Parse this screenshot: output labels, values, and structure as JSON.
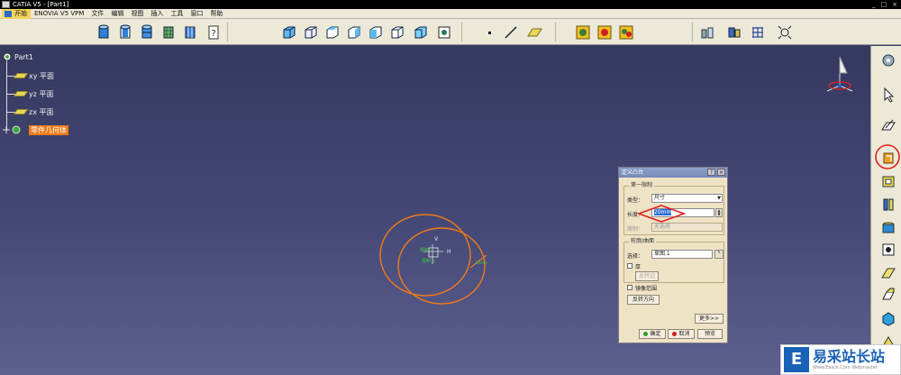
{
  "window": {
    "title": "CATIA V5 - [Part1]",
    "controls": [
      "_",
      "□",
      "×"
    ]
  },
  "menu": {
    "items": [
      "开始",
      "ENOVIA V5 VPM",
      "文件",
      "编辑",
      "视图",
      "插入",
      "工具",
      "窗口",
      "帮助"
    ]
  },
  "toolbar": {
    "icons": [
      "cylinder-icon",
      "cylinder-outline-icon",
      "cylinder-shaded-icon",
      "cylinder-grid-icon",
      "cylinder-wire-icon",
      "help-icon",
      "cube-blue-icon",
      "cube-white-icon",
      "cube-top-icon",
      "cube-side-icon",
      "cube-front-icon",
      "cube-iso-icon",
      "cube-dark-icon",
      "point-icon",
      "line-icon",
      "plane-icon",
      "gear-yellow-icon",
      "gear-red-icon",
      "gear-multi-icon",
      "vise-icon",
      "parts-icon",
      "grid-dots-icon",
      "fit-icon"
    ]
  },
  "tree": {
    "root": "Part1",
    "items": [
      {
        "label": "xy 平面",
        "icon": "plane-icon"
      },
      {
        "label": "yz 平面",
        "icon": "plane-icon"
      },
      {
        "label": "zx 平面",
        "icon": "plane-icon"
      },
      {
        "label": "零件几何体",
        "icon": "body-icon",
        "highlighted": true
      }
    ]
  },
  "dialog": {
    "title": "定义凸台",
    "help": "?",
    "close": "×",
    "limit_group": "第一限制",
    "type_label": "类型：",
    "type_value": "尺寸",
    "length_label": "长度：",
    "length_value": "20mm",
    "limit_label": "限制：",
    "limit_placeholder": "无选择",
    "profile_group": "轮廓/曲面",
    "select_label": "选择：",
    "select_value": "草图.1",
    "thick_label": "厚",
    "reverse_side_label": "反转边",
    "mirror_label": "镜像范围",
    "reverse_dir_label": "反转方向",
    "more_label": "更多>>",
    "ok_label": "确定",
    "cancel_label": "取消",
    "preview_label": "预览"
  },
  "sketch": {
    "labels": [
      "H",
      "V"
    ],
    "accent": "#f07a18",
    "constraint_color": "#3ccc3c"
  },
  "right_toolbar": {
    "icons": [
      "sketcher-gear-icon",
      "select-arrow-icon",
      "sketch-icon",
      "pad-icon",
      "pocket-icon",
      "shaft-icon",
      "hole-icon",
      "rib-icon",
      "fillet-icon",
      "chamfer-icon",
      "shell-icon",
      "draft-icon"
    ],
    "highlighted": "pad-icon"
  },
  "colors": {
    "viewport_top": "#35395f",
    "viewport_bottom": "#5e6190",
    "highlight": "#f07a18",
    "callout": "#e02020"
  },
  "watermark": {
    "logo": "E",
    "title": "易采站长站",
    "subtitle": "Www.Easck.Com  Webmaster"
  }
}
